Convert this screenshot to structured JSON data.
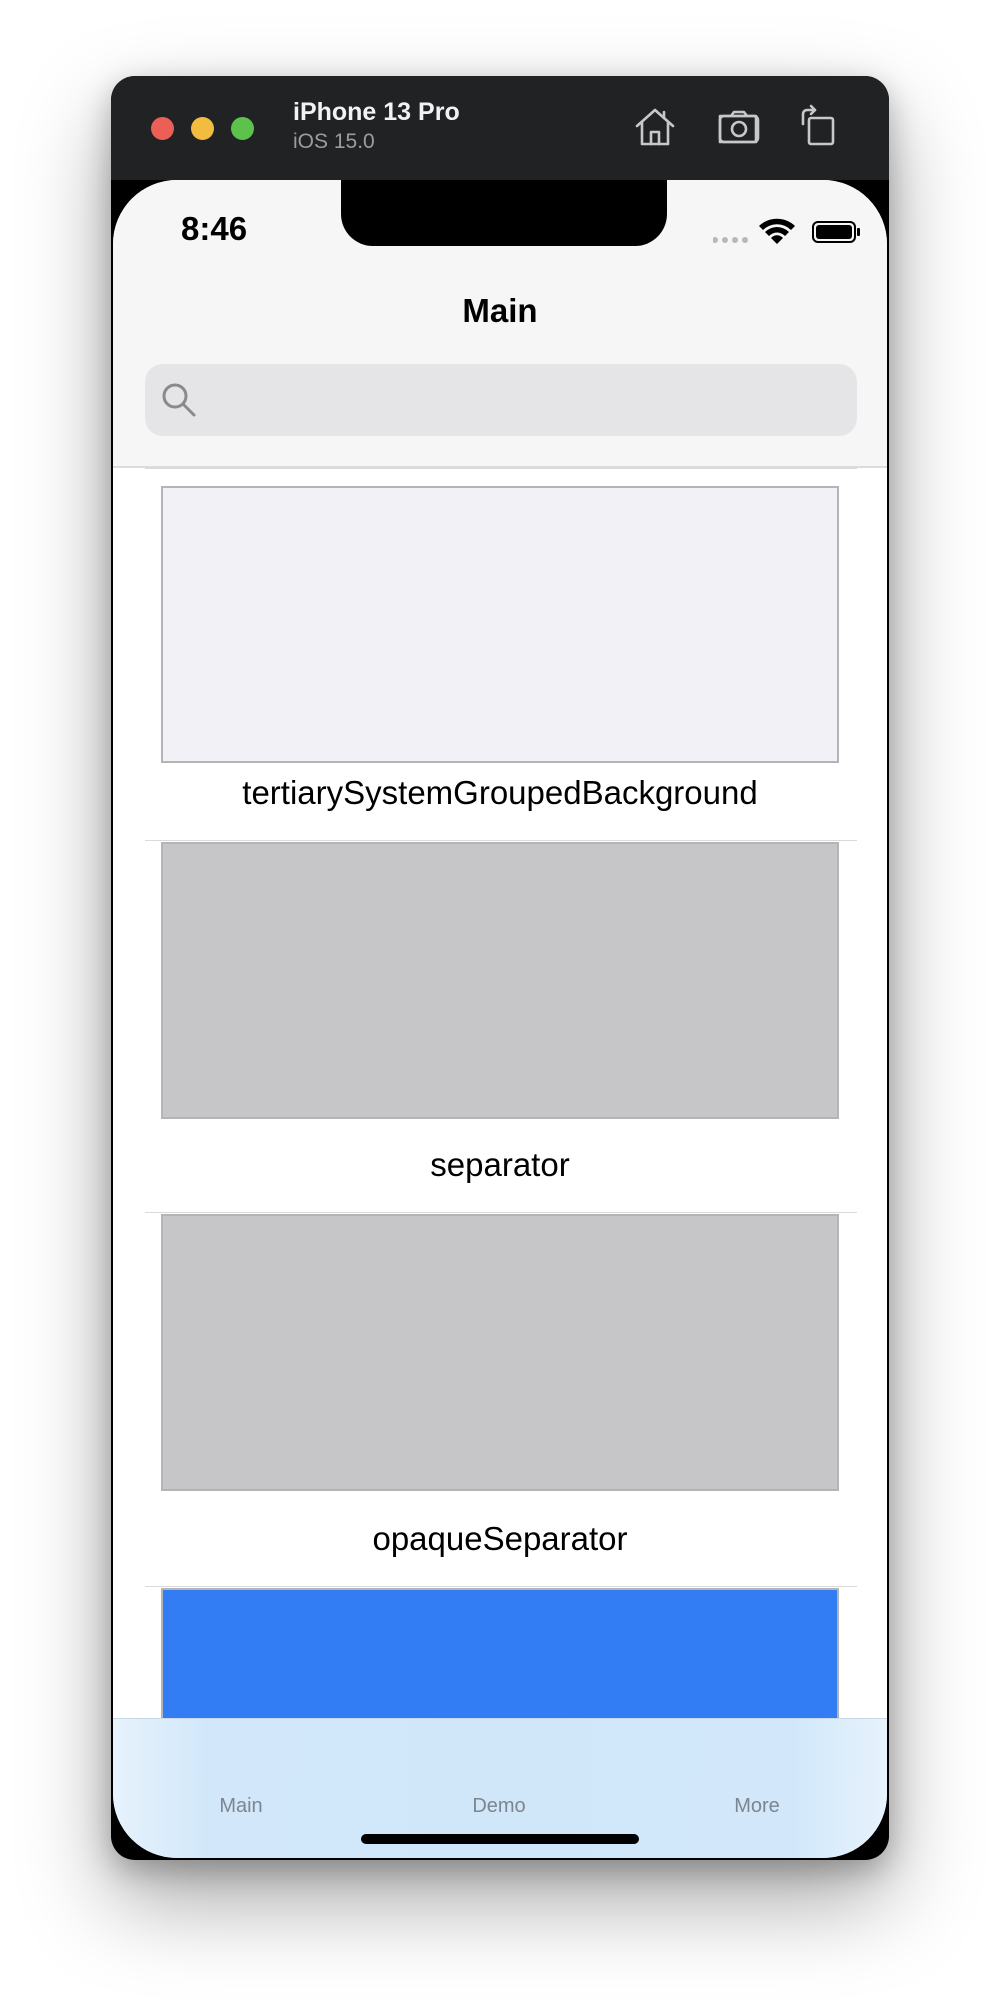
{
  "window": {
    "device_name": "iPhone 13 Pro",
    "os_version": "iOS 15.0"
  },
  "status_bar": {
    "time": "8:46"
  },
  "nav": {
    "title": "Main",
    "search_placeholder": ""
  },
  "list": {
    "rows": [
      {
        "label": "tertiarySystemGroupedBackground",
        "color": "#f1f1f6"
      },
      {
        "label": "separator",
        "color": "#c6c6c8"
      },
      {
        "label": "opaqueSeparator",
        "color": "#c6c6c8"
      },
      {
        "label": "",
        "color": "#327cf4"
      }
    ]
  },
  "tabbar": {
    "tabs": [
      {
        "label": "Main"
      },
      {
        "label": "Demo"
      },
      {
        "label": "More"
      }
    ]
  }
}
